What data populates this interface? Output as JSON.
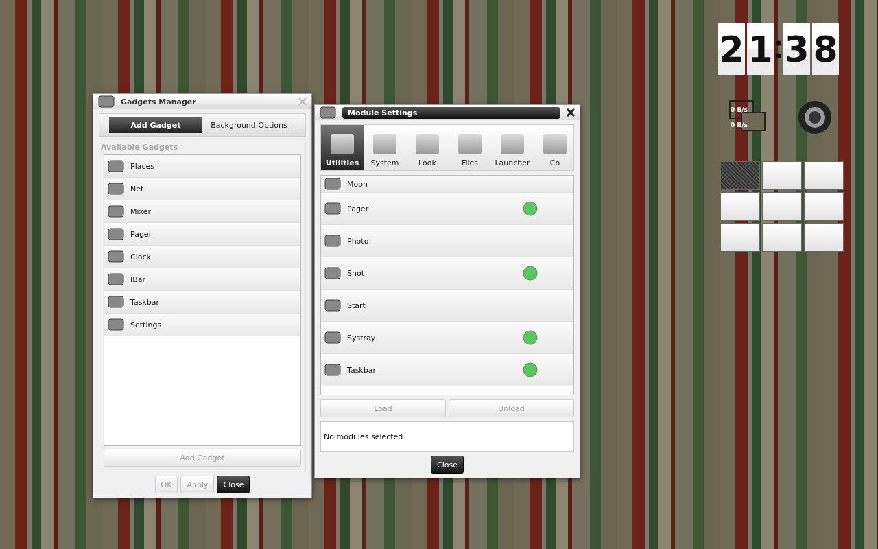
{
  "gadgets_manager": {
    "title": "Gadgets Manager",
    "tabs": [
      {
        "label": "Add Gadget",
        "selected": true
      },
      {
        "label": "Background Options",
        "selected": false
      }
    ],
    "section_label": "Available Gadgets",
    "gadgets": [
      {
        "name": "Places"
      },
      {
        "name": "Net"
      },
      {
        "name": "Mixer"
      },
      {
        "name": "Pager"
      },
      {
        "name": "Clock"
      },
      {
        "name": "IBar"
      },
      {
        "name": "Taskbar"
      },
      {
        "name": "Settings"
      }
    ],
    "add_button": {
      "label": "Add Gadget",
      "disabled": true
    },
    "buttons": [
      {
        "label": "OK",
        "disabled": true,
        "default": false
      },
      {
        "label": "Apply",
        "disabled": true,
        "default": false
      },
      {
        "label": "Close",
        "disabled": false,
        "default": true
      }
    ]
  },
  "module_settings": {
    "title": "Module Settings",
    "categories": [
      {
        "label": "Utilities",
        "selected": true
      },
      {
        "label": "System",
        "selected": false
      },
      {
        "label": "Look",
        "selected": false
      },
      {
        "label": "Files",
        "selected": false
      },
      {
        "label": "Launcher",
        "selected": false
      },
      {
        "label": "Co",
        "selected": false
      }
    ],
    "modules": [
      {
        "name": "Moon",
        "loaded": false
      },
      {
        "name": "Pager",
        "loaded": true
      },
      {
        "name": "Photo",
        "loaded": false
      },
      {
        "name": "Shot",
        "loaded": true
      },
      {
        "name": "Start",
        "loaded": false
      },
      {
        "name": "Systray",
        "loaded": true
      },
      {
        "name": "Taskbar",
        "loaded": true
      }
    ],
    "buttons": [
      {
        "label": "Load",
        "disabled": true
      },
      {
        "label": "Unload",
        "disabled": true
      }
    ],
    "status": "No modules selected.",
    "close": {
      "label": "Close"
    }
  },
  "desktop": {
    "clock": {
      "digits": [
        "2",
        "1",
        "3",
        "8"
      ]
    },
    "net": [
      "0 B/s",
      "0 B/s"
    ],
    "pager": [
      {
        "selected": true
      },
      {
        "selected": false
      },
      {
        "selected": false
      },
      {
        "selected": false
      },
      {
        "selected": false
      },
      {
        "selected": false
      },
      {
        "selected": false
      },
      {
        "selected": false
      },
      {
        "selected": false
      }
    ]
  }
}
